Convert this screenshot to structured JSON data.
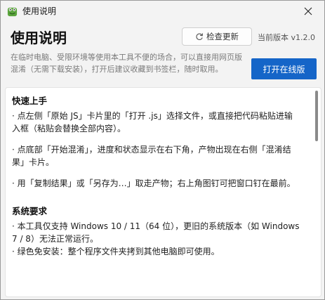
{
  "window": {
    "title": "使用说明",
    "icon": "frog-app-icon",
    "close_icon": "close-icon"
  },
  "header": {
    "title": "使用说明",
    "check_update_label": "检查更新",
    "check_update_icon": "refresh-icon",
    "version_text": "当前版本 v1.2.0",
    "intro": "在临时电脑、受限环境等使用本工具不便的场合，可以直接用网页版混淆（无需下载安装），打开后建议收藏到书签栏，随时取用。",
    "open_online_label": "打开在线版",
    "accent_color": "#1565c8"
  },
  "sections": [
    {
      "title": "快速上手",
      "paragraphs": [
        "· 点左侧「原始 JS」卡片里的「打开 .js」选择文件，或直接把代码粘贴进输入框（粘贴会替换全部内容）。",
        "· 点底部「开始混淆」，进度和状态显示在右下角，产物出现在右侧「混淆结果」卡片。",
        "· 用「复制结果」或「另存为…」取走产物；右上角图钉可把窗口钉在最前。"
      ]
    },
    {
      "title": "系统要求",
      "paragraphs": [
        "· 本工具仅支持 Windows 10 / 11（64 位），更旧的系统版本（如 Windows 7 / 8）无法正常运行。",
        "· 绿色免安装：整个程序文件夹拷到其他电脑即可使用。"
      ]
    }
  ]
}
